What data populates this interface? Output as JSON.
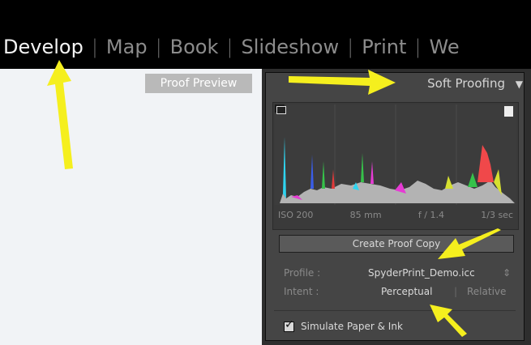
{
  "modules": [
    "Develop",
    "Map",
    "Book",
    "Slideshow",
    "Print",
    "We"
  ],
  "active_module": "Develop",
  "canvas": {
    "label": "Proof Preview"
  },
  "panel": {
    "title": "Soft Proofing",
    "collapse_glyph": "▼",
    "histogram": {
      "iso": "ISO 200",
      "focal": "85 mm",
      "aperture": "f / 1.4",
      "shutter": "1/3 sec"
    },
    "create_button": "Create Proof Copy",
    "profile_label": "Profile :",
    "profile_value": "SpyderPrint_Demo.icc",
    "profile_arrows": "⇕",
    "intent_label": "Intent :",
    "intent_options": [
      "Perceptual",
      "Relative"
    ],
    "intent_separator": "|",
    "simulate_label": "Simulate Paper & Ink",
    "simulate_checked": true,
    "check_glyph": "✓"
  },
  "colors": {
    "accent_arrow": "#f5ef1e",
    "topbar": "#000000",
    "panel_bg": "#454545"
  },
  "icons": [
    "monitor-icon",
    "document-icon",
    "triangle-down-icon",
    "checkbox-icon",
    "stepper-arrows-icon"
  ]
}
